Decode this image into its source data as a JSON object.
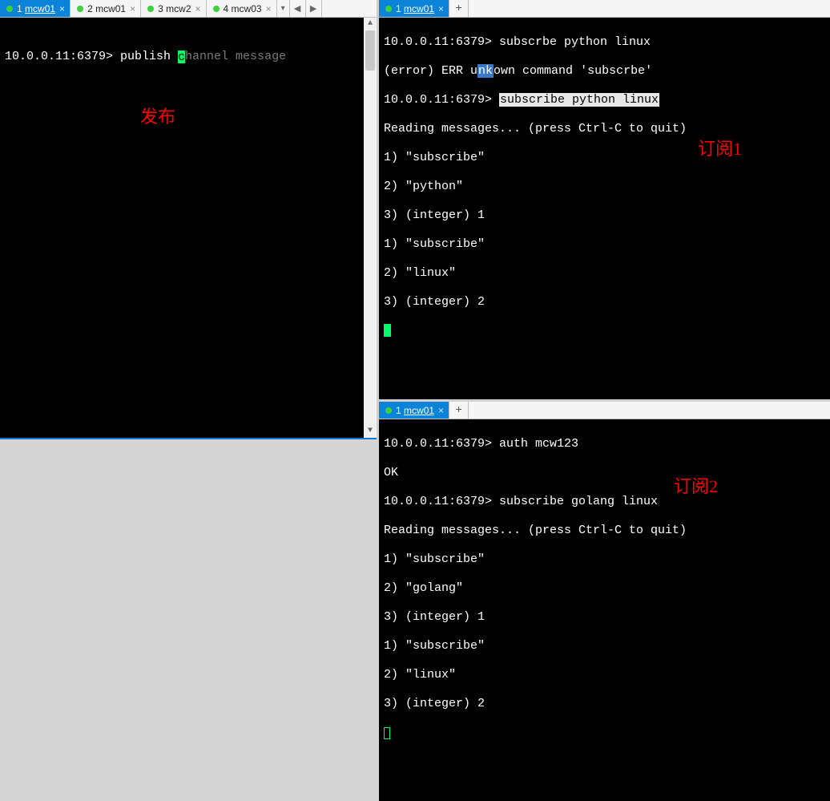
{
  "left": {
    "tabs": [
      {
        "num": "1",
        "label": "mcw01",
        "active": true
      },
      {
        "num": "2",
        "label": "mcw01",
        "active": false
      },
      {
        "num": "3",
        "label": "mcw2",
        "active": false
      },
      {
        "num": "4",
        "label": "mcw03",
        "active": false
      }
    ],
    "prompt": "10.0.0.11:6379> ",
    "cmd": "publish ",
    "cursor_char": "c",
    "hint_after": "hannel message",
    "annotation": "发布"
  },
  "right_top": {
    "tab": {
      "num": "1",
      "label": "mcw01"
    },
    "prompt": "10.0.0.11:6379> ",
    "line1_cmd": "subscrbe python linux",
    "line2_pre": "(error) ERR u",
    "line2_mid": "nk",
    "line2_post": "own command 'subscrbe'",
    "line3_cmd": "subscribe python linux",
    "line4": "Reading messages... (press Ctrl-C to quit)",
    "items": [
      "1) \"subscribe\"",
      "2) \"python\"",
      "3) (integer) 1",
      "1) \"subscribe\"",
      "2) \"linux\"",
      "3) (integer) 2"
    ],
    "annotation": "订阅1"
  },
  "right_bottom": {
    "tab": {
      "num": "1",
      "label": "mcw01"
    },
    "prompt": "10.0.0.11:6379> ",
    "line1_cmd": "auth mcw123",
    "line2": "OK",
    "line3_cmd": "subscribe golang linux",
    "line4": "Reading messages... (press Ctrl-C to quit)",
    "items": [
      "1) \"subscribe\"",
      "2) \"golang\"",
      "3) (integer) 1",
      "1) \"subscribe\"",
      "2) \"linux\"",
      "3) (integer) 2"
    ],
    "annotation": "订阅2"
  }
}
